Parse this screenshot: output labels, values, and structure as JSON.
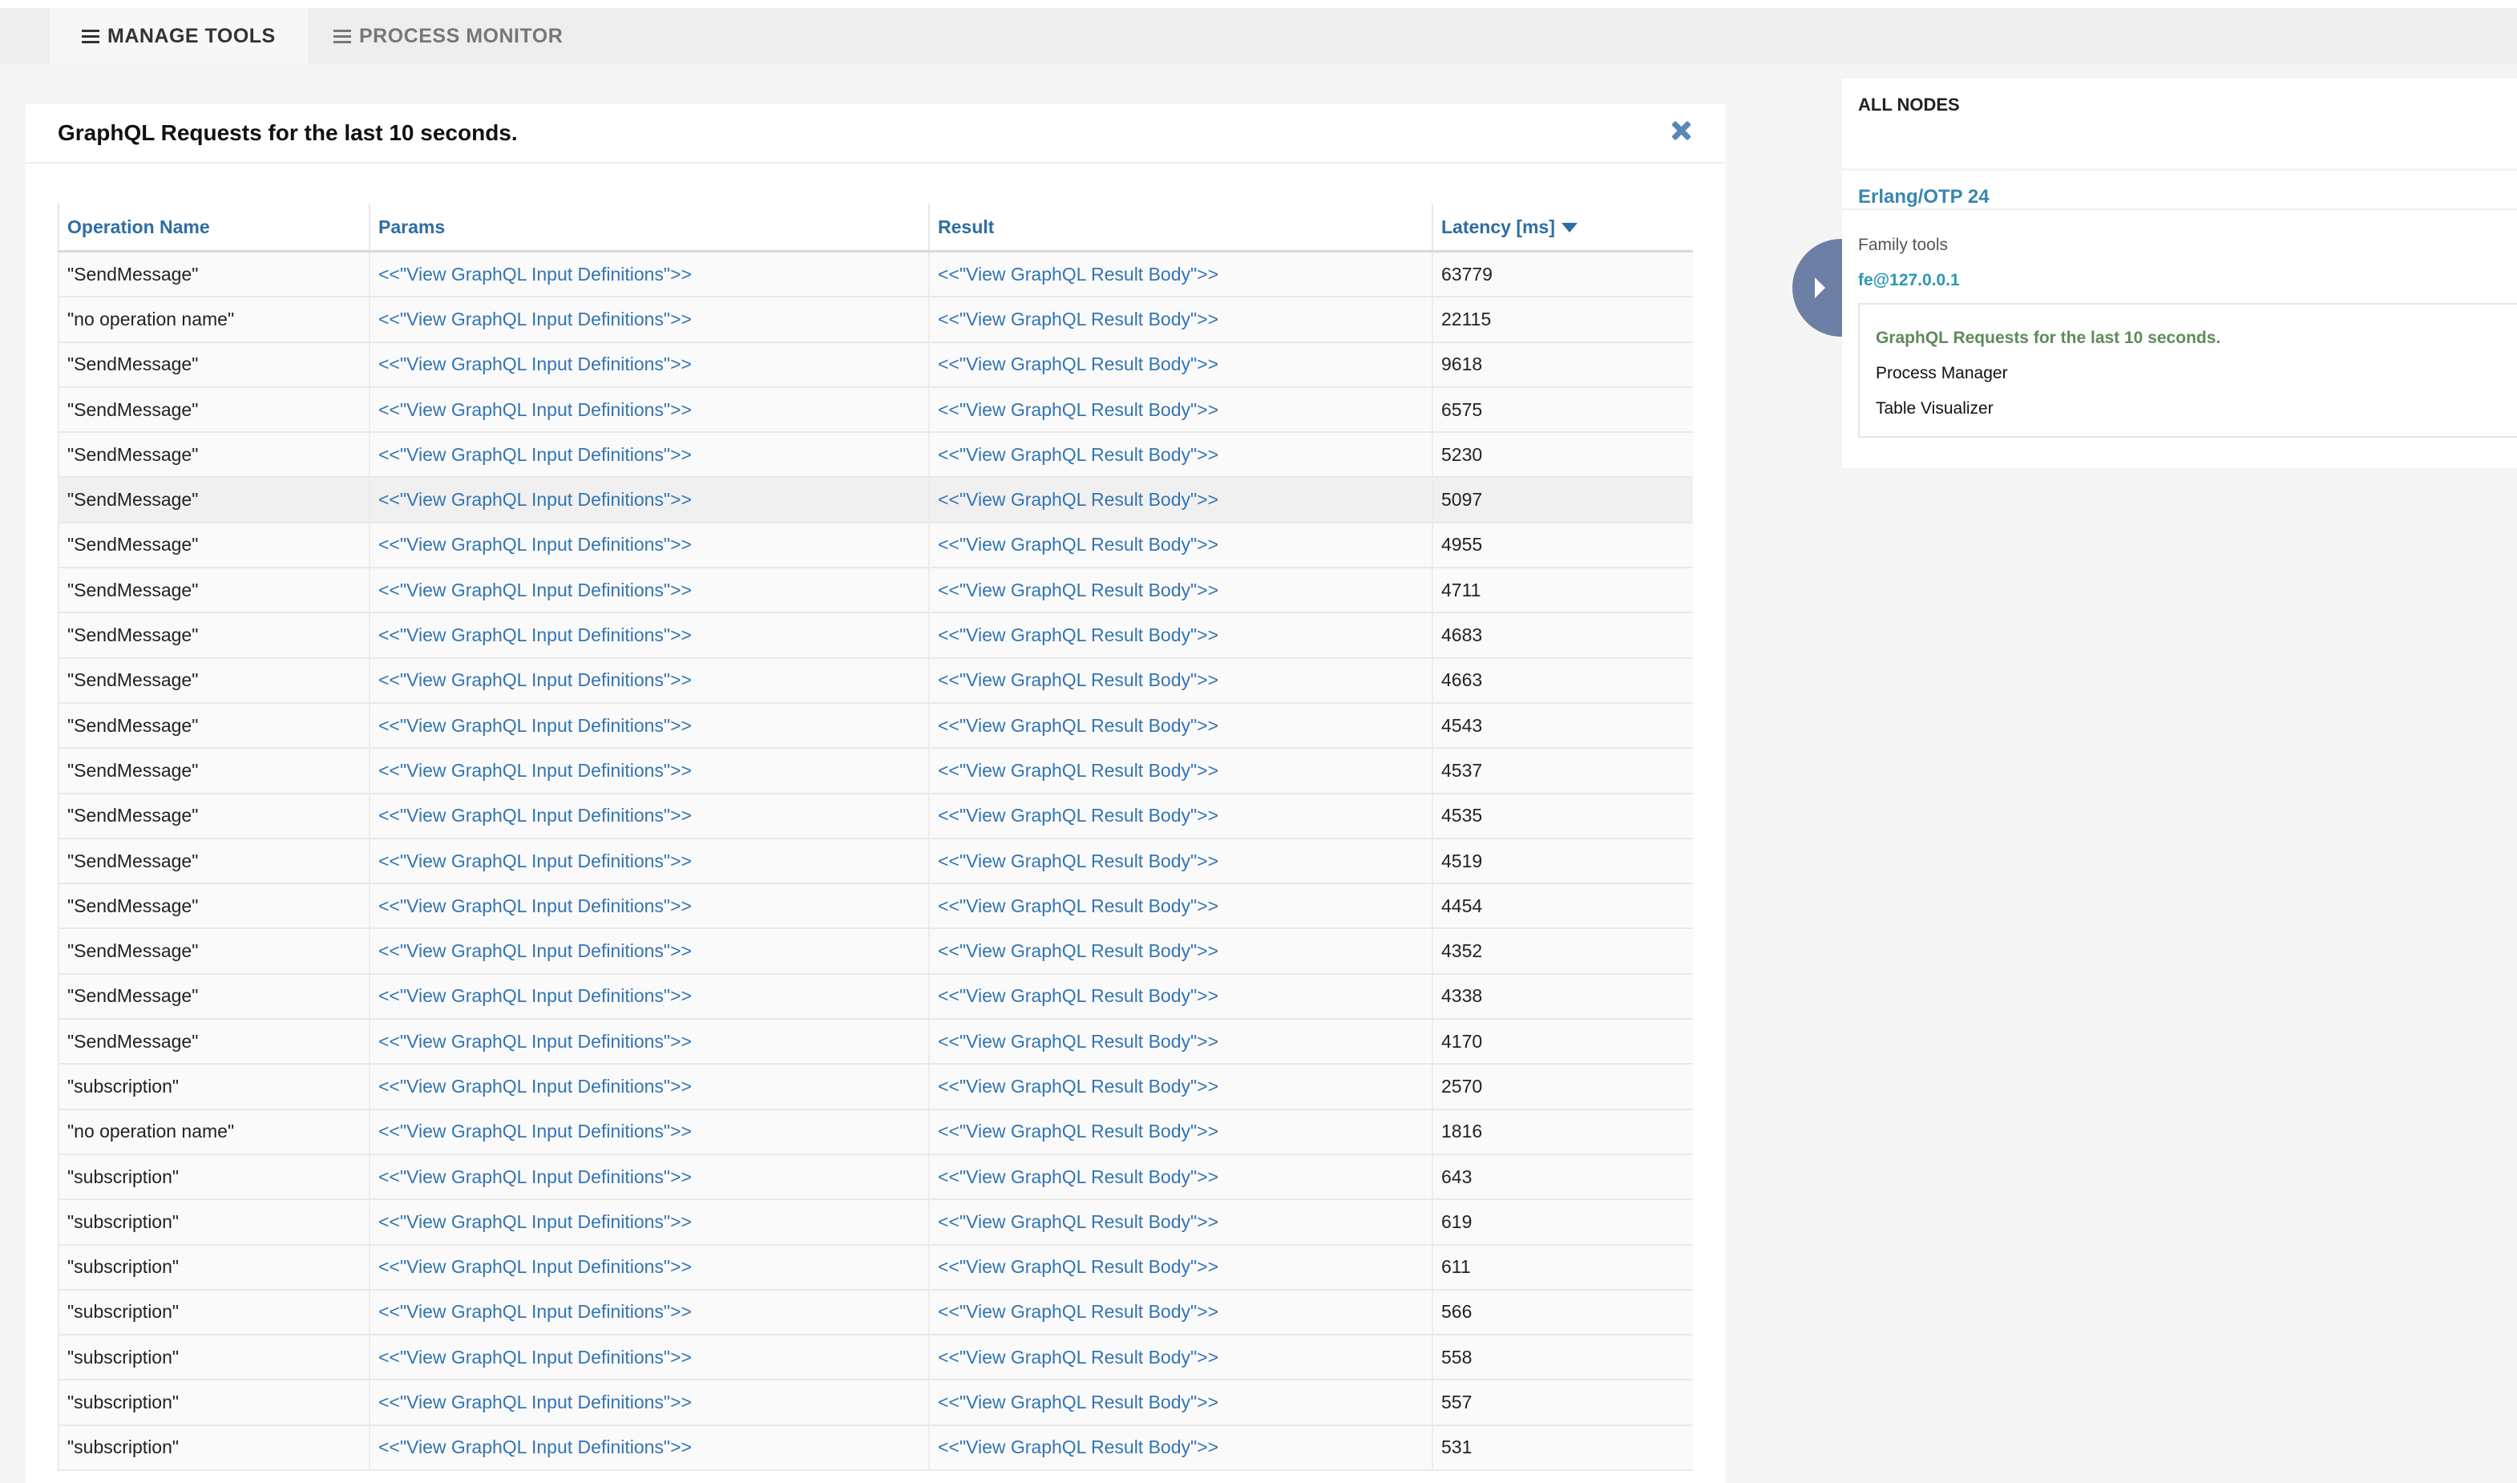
{
  "tabs": [
    {
      "label": "MANAGE TOOLS",
      "active": true
    },
    {
      "label": "PROCESS MONITOR",
      "active": false
    }
  ],
  "panel": {
    "title": "GraphQL Requests for the last 10 seconds."
  },
  "table": {
    "columns": [
      "Operation Name",
      "Params",
      "Result",
      "Latency [ms]"
    ],
    "params_link": "<<\"View GraphQL Input Definitions\">>",
    "result_link": "<<\"View GraphQL Result Body\">>",
    "rows": [
      {
        "op": "\"SendMessage\"",
        "latency": "63779"
      },
      {
        "op": "\"no operation name\"",
        "latency": "22115"
      },
      {
        "op": "\"SendMessage\"",
        "latency": "9618"
      },
      {
        "op": "\"SendMessage\"",
        "latency": "6575"
      },
      {
        "op": "\"SendMessage\"",
        "latency": "5230"
      },
      {
        "op": "\"SendMessage\"",
        "latency": "5097"
      },
      {
        "op": "\"SendMessage\"",
        "latency": "4955"
      },
      {
        "op": "\"SendMessage\"",
        "latency": "4711"
      },
      {
        "op": "\"SendMessage\"",
        "latency": "4683"
      },
      {
        "op": "\"SendMessage\"",
        "latency": "4663"
      },
      {
        "op": "\"SendMessage\"",
        "latency": "4543"
      },
      {
        "op": "\"SendMessage\"",
        "latency": "4537"
      },
      {
        "op": "\"SendMessage\"",
        "latency": "4535"
      },
      {
        "op": "\"SendMessage\"",
        "latency": "4519"
      },
      {
        "op": "\"SendMessage\"",
        "latency": "4454"
      },
      {
        "op": "\"SendMessage\"",
        "latency": "4352"
      },
      {
        "op": "\"SendMessage\"",
        "latency": "4338"
      },
      {
        "op": "\"SendMessage\"",
        "latency": "4170"
      },
      {
        "op": "\"subscription\"",
        "latency": "2570"
      },
      {
        "op": "\"no operation name\"",
        "latency": "1816"
      },
      {
        "op": "\"subscription\"",
        "latency": "643"
      },
      {
        "op": "\"subscription\"",
        "latency": "619"
      },
      {
        "op": "\"subscription\"",
        "latency": "611"
      },
      {
        "op": "\"subscription\"",
        "latency": "566"
      },
      {
        "op": "\"subscription\"",
        "latency": "558"
      },
      {
        "op": "\"subscription\"",
        "latency": "557"
      },
      {
        "op": "\"subscription\"",
        "latency": "531"
      }
    ]
  },
  "sidebar": {
    "header": "ALL NODES",
    "otp": "Erlang/OTP 24",
    "family_label": "Family tools",
    "node": "fe@127.0.0.1",
    "menu": [
      "GraphQL Requests for the last 10 seconds.",
      "Process Manager",
      "Table Visualizer"
    ]
  },
  "icons": {
    "tab_icon": "list-icon",
    "close": "close-icon",
    "sort": "caret-down-icon",
    "toggle": "chevron-right-icon"
  },
  "colors": {
    "link": "#3374b2",
    "header_link": "#2e6da4",
    "menu_active": "#5f8a5b",
    "toggle": "#6d7fa5"
  }
}
